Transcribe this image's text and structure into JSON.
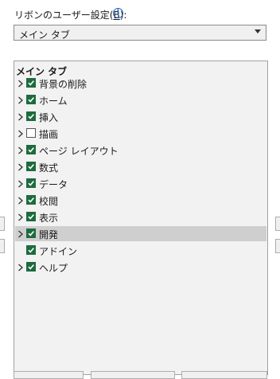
{
  "ribbon": {
    "label_prefix": "リボンのユーザー設定(",
    "label_key": "B",
    "label_suffix": "):",
    "info_icon": "i",
    "selected_option": "メイン タブ"
  },
  "tree": {
    "header": "メイン タブ",
    "items": [
      {
        "label": "背景の削除",
        "checked": true,
        "expander": true
      },
      {
        "label": "ホーム",
        "checked": true,
        "expander": true
      },
      {
        "label": "挿入",
        "checked": true,
        "expander": true
      },
      {
        "label": "描画",
        "checked": false,
        "expander": true
      },
      {
        "label": "ページ レイアウト",
        "checked": true,
        "expander": true
      },
      {
        "label": "数式",
        "checked": true,
        "expander": true
      },
      {
        "label": "データ",
        "checked": true,
        "expander": true
      },
      {
        "label": "校閲",
        "checked": true,
        "expander": true
      },
      {
        "label": "表示",
        "checked": true,
        "expander": true
      },
      {
        "label": "開発",
        "checked": true,
        "expander": true,
        "selected": true
      },
      {
        "label": "アドイン",
        "checked": true,
        "expander": false
      },
      {
        "label": "ヘルプ",
        "checked": true,
        "expander": true
      }
    ]
  },
  "colors": {
    "checkbox_checked": "#1e6b3e",
    "selection": "#cfcfcf",
    "info": "#1f5fbf"
  }
}
